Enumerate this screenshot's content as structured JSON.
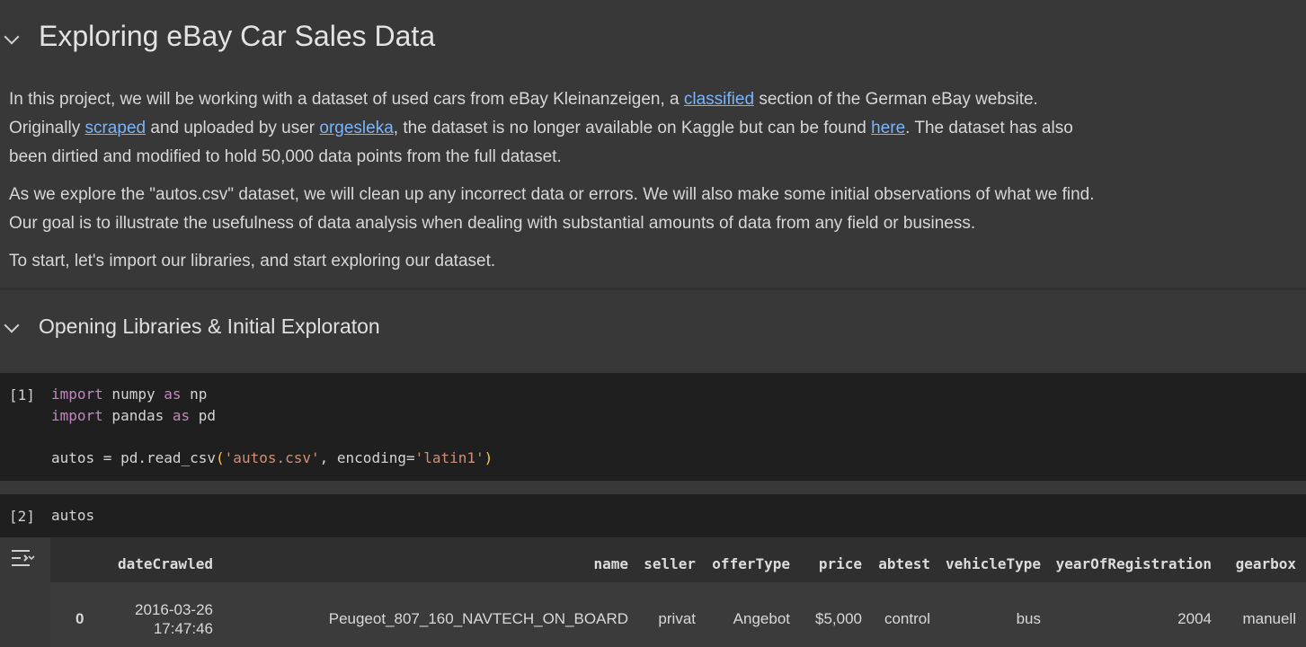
{
  "heading1": "Exploring eBay Car Sales Data",
  "intro": {
    "p1_line1_a": "In this project, we will be working with a dataset of used cars from eBay Kleinanzeigen, a ",
    "p1_link_classified": "classified",
    "p1_line1_b": " section of the German eBay website.",
    "p1_line2_a": "Originally ",
    "p1_link_scraped": "scraped",
    "p1_line2_b": " and uploaded by user ",
    "p1_link_user": "orgesleka",
    "p1_line2_c": ", the dataset is no longer available on Kaggle but can be found ",
    "p1_link_here": "here",
    "p1_line2_d": ". The dataset has also",
    "p1_line3": "been dirtied and modified to hold 50,000 data points from the full dataset.",
    "p2_line1": "As we explore the \"autos.csv\" dataset, we will clean up any incorrect data or errors. We will also make some initial observations of what we find.",
    "p2_line2": "Our goal is to illustrate the usefulness of data analysis when dealing with substantial amounts of data from any field or business.",
    "p3": "To start, let's import our libraries, and start exploring our dataset."
  },
  "heading2": "Opening Libraries & Initial Exploraton",
  "cell1": {
    "count": "[1]",
    "line1": {
      "kw": "import",
      "a": " numpy ",
      "as": "as",
      "b": " np"
    },
    "line2": {
      "kw": "import",
      "a": " pandas ",
      "as": "as",
      "b": " pd"
    },
    "line3": {
      "a": "autos = pd.read_csv",
      "open": "(",
      "s1": "'autos.csv'",
      "b": ", encoding=",
      "s2": "'latin1'",
      "close": ")"
    }
  },
  "cell2": {
    "count": "[2]",
    "code": "autos"
  },
  "output": {
    "icon": "output-toggle-icon",
    "columns": [
      "dateCrawled",
      "name",
      "seller",
      "offerType",
      "price",
      "abtest",
      "vehicleType",
      "yearOfRegistration",
      "gearbox"
    ],
    "rows": [
      {
        "index": "0",
        "dateCrawled_1": "2016-03-26",
        "dateCrawled_2": "17:47:46",
        "name": "Peugeot_807_160_NAVTECH_ON_BOARD",
        "seller": "privat",
        "offerType": "Angebot",
        "price": "$5,000",
        "abtest": "control",
        "vehicleType": "bus",
        "yearOfRegistration": "2004",
        "gearbox": "manuell"
      }
    ]
  },
  "colors": {
    "background": "#383838",
    "code_bg": "#1f1f1f",
    "link": "#7cb4f7",
    "keyword": "#c586c0",
    "string": "#ce9178"
  }
}
